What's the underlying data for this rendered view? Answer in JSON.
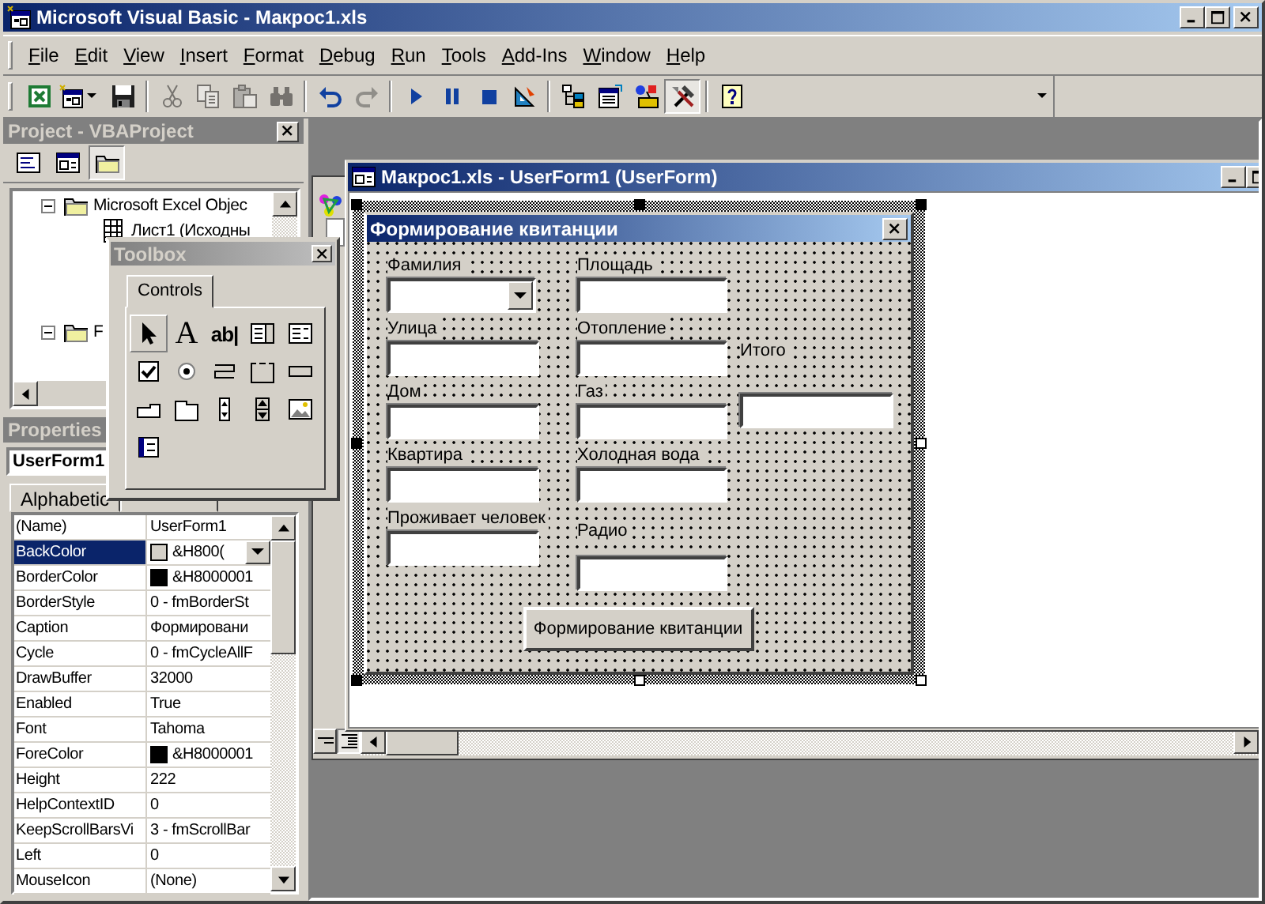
{
  "window": {
    "title": "Microsoft Visual Basic - Макрос1.xls"
  },
  "menu": [
    "File",
    "Edit",
    "View",
    "Insert",
    "Format",
    "Debug",
    "Run",
    "Tools",
    "Add-Ins",
    "Window",
    "Help"
  ],
  "toolbar": {
    "groups": [
      [
        {
          "disabled": false,
          "pressed": false
        },
        {
          "disabled": false,
          "pressed": false
        },
        {
          "disabled": false,
          "pressed": false
        }
      ],
      [
        {
          "disabled": true,
          "pressed": false
        },
        {
          "disabled": true,
          "pressed": false
        },
        {
          "disabled": true,
          "pressed": false
        },
        {
          "disabled": true,
          "pressed": false
        }
      ],
      [
        {
          "disabled": false,
          "pressed": false
        },
        {
          "disabled": true,
          "pressed": false
        }
      ],
      [
        {
          "disabled": false,
          "pressed": false
        },
        {
          "disabled": false,
          "pressed": false
        },
        {
          "disabled": false,
          "pressed": false
        },
        {
          "disabled": false,
          "pressed": false
        }
      ],
      [
        {
          "disabled": false,
          "pressed": false
        },
        {
          "disabled": false,
          "pressed": false
        },
        {
          "disabled": false,
          "pressed": false
        },
        {
          "disabled": false,
          "pressed": true
        }
      ],
      [
        {
          "disabled": false,
          "pressed": false
        }
      ]
    ]
  },
  "project": {
    "title": "Project - VBAProject",
    "buttons": [
      {
        "pressed": false
      },
      {
        "pressed": false
      },
      {
        "pressed": true
      }
    ],
    "tree": [
      {
        "kind": "folder",
        "label": "Microsoft Excel Objec",
        "expanded": true,
        "children": [
          {
            "kind": "sheet",
            "label": "Лист1 (Исходны"
          }
        ]
      },
      {
        "kind": "folder",
        "label": "F",
        "expanded": true
      }
    ]
  },
  "properties": {
    "title": "Properties",
    "object": "UserForm1",
    "tabs": [
      {
        "label": "Alphabetic",
        "selected": true
      },
      {
        "selected": false
      }
    ],
    "rows": [
      {
        "name": "(Name)",
        "value": "UserForm1",
        "selected": false
      },
      {
        "name": "BackColor",
        "value": "&H800(",
        "color": "#d4d0c8",
        "selected": true
      },
      {
        "name": "BorderColor",
        "value": "&H8000001",
        "color": "#000000",
        "selected": false
      },
      {
        "name": "BorderStyle",
        "value": "0 - fmBorderSt",
        "selected": false
      },
      {
        "name": "Caption",
        "value": "Формировани",
        "selected": false
      },
      {
        "name": "Cycle",
        "value": "0 - fmCycleAllF",
        "selected": false
      },
      {
        "name": "DrawBuffer",
        "value": "32000",
        "selected": false
      },
      {
        "name": "Enabled",
        "value": "True",
        "selected": false
      },
      {
        "name": "Font",
        "value": "Tahoma",
        "selected": false
      },
      {
        "name": "ForeColor",
        "value": "&H8000001",
        "color": "#000000",
        "selected": false
      },
      {
        "name": "Height",
        "value": "222",
        "selected": false
      },
      {
        "name": "HelpContextID",
        "value": "0",
        "selected": false
      },
      {
        "name": "KeepScrollBarsVi",
        "value": "3 - fmScrollBar",
        "selected": false
      },
      {
        "name": "Left",
        "value": "0",
        "selected": false
      },
      {
        "name": "MouseIcon",
        "value": "(None)",
        "selected": false
      }
    ]
  },
  "designer": {
    "title": "Макрос1.xls - UserForm1 (UserForm)",
    "form": {
      "title": "Формирование квитанции",
      "columns": [
        [
          {
            "kind": "label",
            "text": "Фамилия"
          },
          {
            "kind": "combobox"
          },
          {
            "kind": "label",
            "text": "Улица"
          },
          {
            "kind": "textbox"
          },
          {
            "kind": "label",
            "text": "Дом"
          },
          {
            "kind": "textbox"
          },
          {
            "kind": "label",
            "text": "Квартира"
          },
          {
            "kind": "textbox"
          },
          {
            "kind": "label",
            "text": "Проживает человек"
          },
          {
            "kind": "textbox"
          }
        ],
        [
          {
            "kind": "label",
            "text": "Площадь"
          },
          {
            "kind": "textbox"
          },
          {
            "kind": "label",
            "text": "Отопление"
          },
          {
            "kind": "textbox"
          },
          {
            "kind": "label",
            "text": "Газ"
          },
          {
            "kind": "textbox"
          },
          {
            "kind": "label",
            "text": "Холодная вода"
          },
          {
            "kind": "textbox"
          },
          {
            "kind": "label",
            "text": "Радио"
          },
          {
            "kind": "textbox"
          }
        ],
        [
          {
            "kind": "label",
            "text": "Итого"
          },
          {
            "kind": "textbox"
          }
        ]
      ],
      "button": "Формирование квитанции"
    }
  },
  "toolbox": {
    "title": "Toolbox",
    "tabs": [
      {
        "label": "Controls",
        "selected": true
      }
    ],
    "tools": [
      {
        "selected": true
      },
      {
        "selected": false,
        "glyph": "A"
      },
      {
        "selected": false,
        "glyph": "ab|"
      },
      {
        "selected": false
      },
      {
        "selected": false
      },
      {
        "selected": false
      },
      {
        "selected": false
      },
      {
        "selected": false
      },
      {
        "selected": false
      },
      {
        "selected": false
      },
      {
        "selected": false
      },
      {
        "selected": false
      },
      {
        "selected": false
      },
      {
        "selected": false
      },
      {
        "selected": false
      },
      {
        "selected": false
      }
    ]
  }
}
